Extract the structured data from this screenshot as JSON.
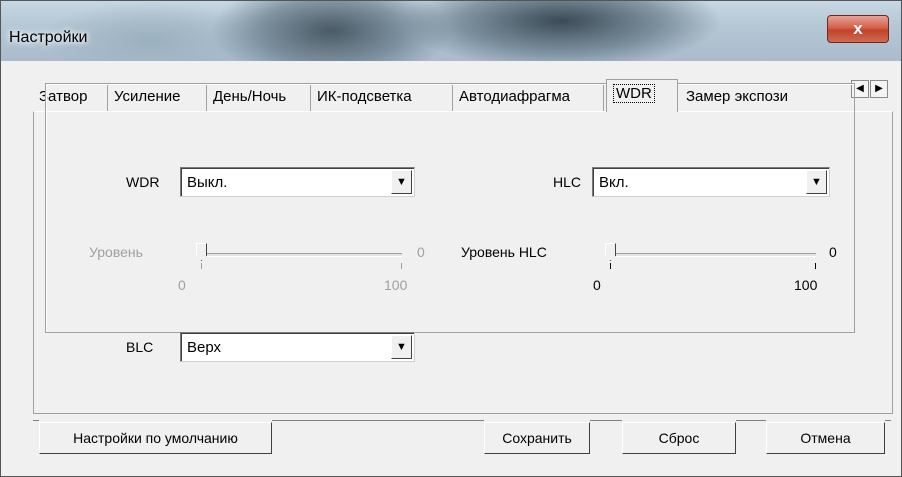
{
  "window": {
    "title": "Настройки",
    "close_glyph": "x"
  },
  "tabs": [
    "Затвор",
    "Усиление",
    "День/Ночь",
    "ИК-подсветка",
    "Автодиафрагма",
    "WDR",
    "Замер экспози"
  ],
  "active_tab": "WDR",
  "tab_nav": {
    "left_glyph": "◀",
    "right_glyph": "▶"
  },
  "wdr": {
    "label": "WDR",
    "value": "Выкл."
  },
  "hlc": {
    "label": "HLC",
    "value": "Вкл."
  },
  "level": {
    "label": "Уровень",
    "value": "0",
    "min": "0",
    "max": "100",
    "enabled": false
  },
  "hlc_level": {
    "label": "Уровень HLC",
    "value": "0",
    "min": "0",
    "max": "100",
    "enabled": true
  },
  "blc": {
    "label": "BLC",
    "value": "Верх"
  },
  "buttons": {
    "defaults": "Настройки по умолчанию",
    "save": "Сохранить",
    "reset": "Сброс",
    "cancel": "Отмена"
  },
  "dropdown_glyph": "▼"
}
